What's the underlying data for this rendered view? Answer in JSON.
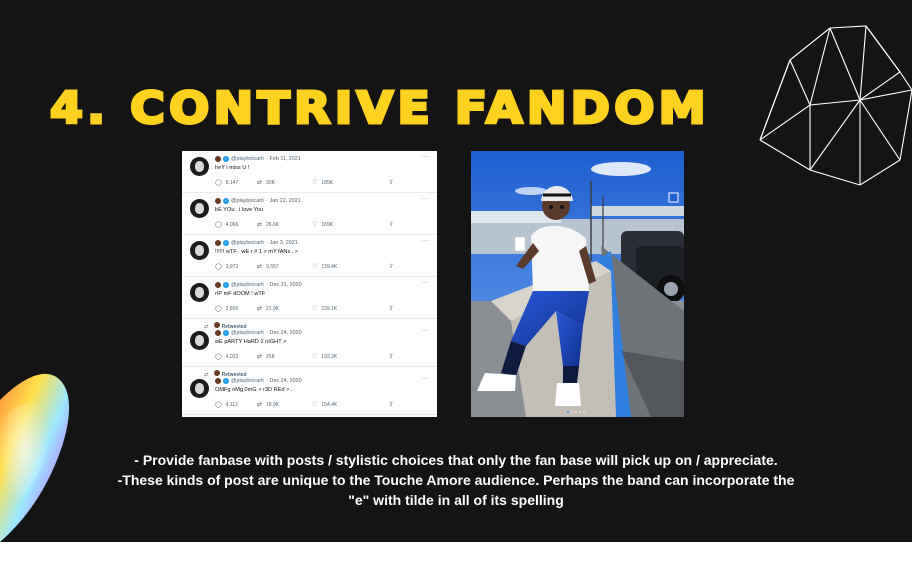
{
  "slide": {
    "title": "4. CONTRIVE FANDOM",
    "title_color": "#ffd21f",
    "background": "#141414",
    "caption_lines": [
      "- Provide fanbase with posts / stylistic choices that only the fan base will pick up on / appreciate.",
      "-These kinds of post are unique to the Touche Amore audience. Perhaps the  band can incorporate the",
      "\"e\" with tilde in all of its spelling"
    ]
  },
  "tweets": [
    {
      "retweeted": false,
      "handle": "@playboicarti",
      "date": "Feb 11, 2021",
      "text": "heY i miss U !",
      "replies": "8,147",
      "retweets": "30K",
      "likes": "185K"
    },
    {
      "retweeted": false,
      "handle": "@playboicarti",
      "date": "Jan 22, 2021",
      "text": "bE YOu . i love You",
      "replies": "4,066",
      "retweets": "26.6K",
      "likes": "169K"
    },
    {
      "retweeted": false,
      "handle": "@playboicarti",
      "date": "Jan 3, 2021",
      "text": "!!!!!! wTF . wE r # 1 > mY fANs . >",
      "replies": "3,972",
      "retweets": "9,557",
      "likes": "139.4K"
    },
    {
      "retweeted": false,
      "handle": "@playboicarti",
      "date": "Dec 31, 2020",
      "text": "rIP mF dOOM ! wTF",
      "replies": "2,800",
      "retweets": "21.9K",
      "likes": "239.1K"
    },
    {
      "retweeted": true,
      "retweet_label": "Retweeted",
      "handle": "@playboicarti",
      "date": "Dec 24, 2020",
      "text": "wE pARTY HaRD 2 nIGHT >",
      "replies": "4,022",
      "retweets": "25K",
      "likes": "192.2K"
    },
    {
      "retweeted": true,
      "retweet_label": "Retweeted",
      "handle": "@playboicarti",
      "date": "Dec 24, 2020",
      "text": "OMFg oMg 0mG > r3D REd > .",
      "replies": "4,112",
      "retweets": "18.9K",
      "likes": "154.4K"
    }
  ],
  "icons": {
    "reply": "speech-bubble-icon",
    "retweet": "retweet-icon",
    "like": "heart-icon",
    "share": "share-icon",
    "more": "more-icon",
    "verified": "verified-badge-icon"
  },
  "photo": {
    "carousel_count": 5,
    "carousel_active": 0
  }
}
